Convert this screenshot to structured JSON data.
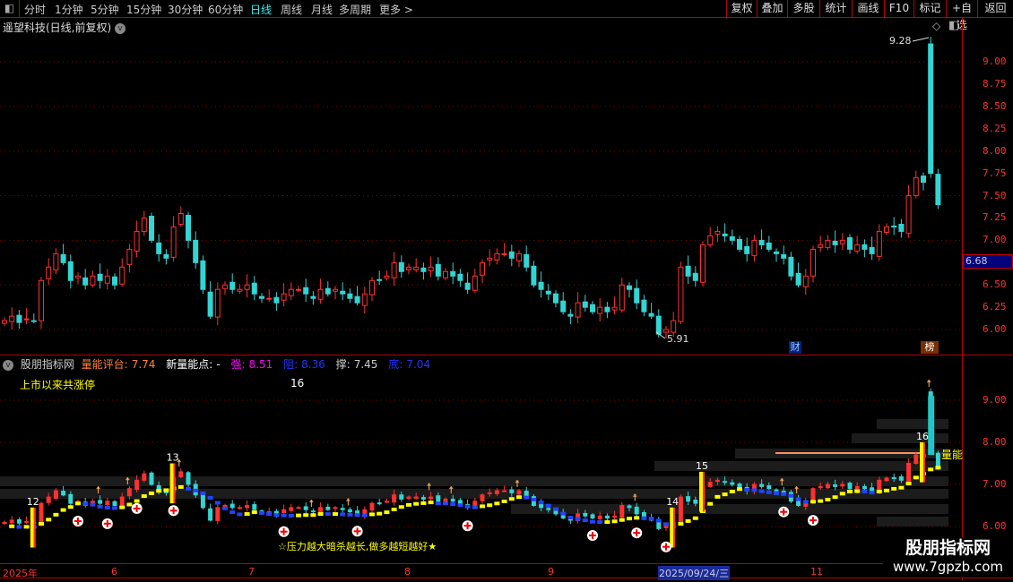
{
  "toolbar": {
    "periods": [
      "分时",
      "1分钟",
      "5分钟",
      "15分钟",
      "30分钟",
      "60分钟",
      "日线",
      "周线",
      "月线",
      "多周期",
      "更多 >"
    ],
    "active_period": "日线",
    "buttons": [
      "复权",
      "叠加",
      "多股",
      "统计",
      "画线",
      "F10",
      "标记",
      "+自选",
      "返回"
    ]
  },
  "main": {
    "title": "遥望科技(日线,前复权)",
    "price_axis": [
      "9.00",
      "8.75",
      "8.50",
      "8.25",
      "8.00",
      "7.75",
      "7.50",
      "7.25",
      "7.00",
      "6.75",
      "6.50",
      "6.25",
      "6.00"
    ],
    "current_price": "6.68",
    "high_label": "9.28",
    "low_label": "5.91",
    "badge_finance": "财",
    "badge_rank": "榜",
    "ylim": [
      5.85,
      9.45
    ]
  },
  "candles_close": [
    6.1,
    6.15,
    6.08,
    6.12,
    6.1,
    6.55,
    6.7,
    6.85,
    6.75,
    6.55,
    6.6,
    6.5,
    6.6,
    6.55,
    6.6,
    6.5,
    6.7,
    6.9,
    7.1,
    7.25,
    7.0,
    6.85,
    6.8,
    7.15,
    7.3,
    7.0,
    6.75,
    6.45,
    6.15,
    6.45,
    6.5,
    6.45,
    6.45,
    6.5,
    6.4,
    6.35,
    6.35,
    6.3,
    6.4,
    6.45,
    6.45,
    6.4,
    6.35,
    6.45,
    6.4,
    6.45,
    6.4,
    6.35,
    6.3,
    6.4,
    6.55,
    6.55,
    6.6,
    6.75,
    6.65,
    6.7,
    6.7,
    6.65,
    6.7,
    6.6,
    6.65,
    6.6,
    6.55,
    6.45,
    6.6,
    6.75,
    6.8,
    6.85,
    6.85,
    6.8,
    6.85,
    6.7,
    6.5,
    6.45,
    6.4,
    6.3,
    6.2,
    6.15,
    6.3,
    6.25,
    6.2,
    6.25,
    6.2,
    6.25,
    6.5,
    6.45,
    6.3,
    6.2,
    6.15,
    5.95,
    6.0,
    6.1,
    6.7,
    6.6,
    6.55,
    6.95,
    7.05,
    7.1,
    7.05,
    7.0,
    6.9,
    6.85,
    7.0,
    6.95,
    6.9,
    6.85,
    6.8,
    6.6,
    6.5,
    6.6,
    6.9,
    6.95,
    7.0,
    6.95,
    7.0,
    6.9,
    6.95,
    6.9,
    6.85,
    7.1,
    7.15,
    7.15,
    7.1,
    7.5,
    7.7,
    7.65,
    7.75,
    7.4
  ],
  "indicator": {
    "name": "股朋指标网",
    "score_label": "量能评台:",
    "score": "7.74",
    "new_point_label": "新量能点:",
    "new_point": "-",
    "strong_label": "强:",
    "strong": "8.51",
    "resist_label": "阻:",
    "resist": "8.36",
    "support_label": "撑:",
    "support": "7.45",
    "bottom_label": "底:",
    "bottom": "7.04",
    "limit_up_label": "上市以来共涨停",
    "limit_up_count": "16",
    "axis": [
      "9.00",
      "8.00",
      "7.00",
      "6.00"
    ],
    "ylim": [
      5.75,
      9.6
    ],
    "limit_up_numbers": [
      "12",
      "13",
      "14",
      "15",
      "16"
    ],
    "line_label": "量能",
    "slogan": "☆压力越大暗杀越长,做多越短越好★"
  },
  "time_axis": [
    "2025年",
    "6",
    "7",
    "8",
    "9",
    "2025/09/24/三",
    "11"
  ],
  "watermark": {
    "name": "股朋指标网",
    "url": "www.7gpzb.com"
  },
  "colors": {
    "up": "#ff3030",
    "down": "#33d4d4",
    "active": "#33eeee",
    "grid": "#b00000",
    "ma_up": "#ffff00",
    "ma_down": "#2244ff"
  }
}
